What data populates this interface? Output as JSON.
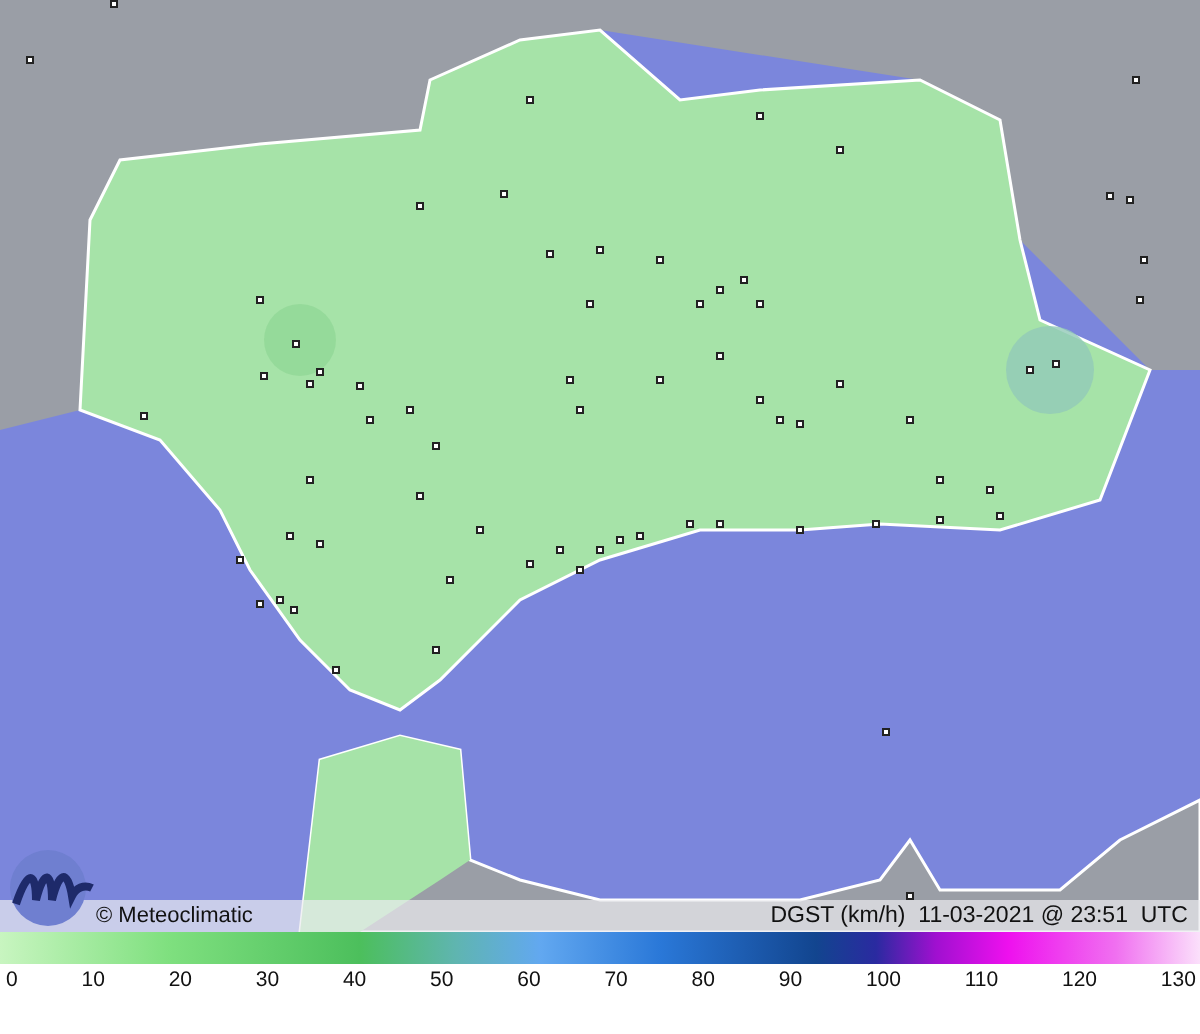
{
  "credit": "© Meteoclimatic",
  "caption": "DGST (km/h)  11-03-2021 @ 23:51  UTC",
  "legend": {
    "ticks": [
      "0",
      "10",
      "20",
      "30",
      "40",
      "50",
      "60",
      "70",
      "80",
      "90",
      "100",
      "110",
      "120",
      "130"
    ]
  }
}
